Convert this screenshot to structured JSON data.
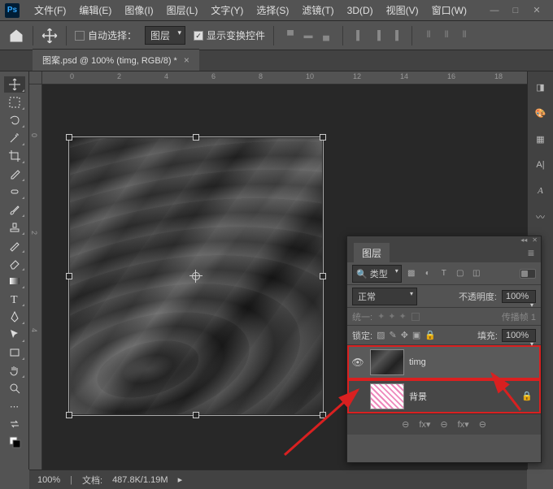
{
  "app": {
    "logo": "Ps"
  },
  "menu": {
    "file": "文件(F)",
    "edit": "编辑(E)",
    "image": "图像(I)",
    "layer": "图层(L)",
    "type": "文字(Y)",
    "select": "选择(S)",
    "filter": "滤镜(T)",
    "threed": "3D(D)",
    "view": "视图(V)",
    "window": "窗口(W)"
  },
  "options": {
    "auto_select_label": "自动选择：",
    "auto_select_mode": "图层",
    "show_transform_label": "显示变换控件"
  },
  "document": {
    "tab_title": "图案.psd @ 100% (timg, RGB/8) *"
  },
  "ruler": {
    "h": [
      "0",
      "2",
      "4",
      "6",
      "8",
      "10",
      "12",
      "14",
      "16",
      "18"
    ],
    "v": [
      "0",
      "2",
      "4"
    ]
  },
  "layers_panel": {
    "tab": "图层",
    "filter_label": "类型",
    "blend_mode": "正常",
    "opacity_label": "不透明度:",
    "opacity_value": "100%",
    "unify_label": "统一:",
    "propagate_label": "传播帧 1",
    "lock_label": "锁定:",
    "fill_label": "填充:",
    "fill_value": "100%",
    "items": [
      {
        "name": "timg",
        "visible": true,
        "selected": true,
        "locked": false
      },
      {
        "name": "背景",
        "visible": false,
        "selected": false,
        "locked": true
      }
    ],
    "footer_icons": [
      "⊖",
      "fx",
      "⊖",
      "fx",
      "⊖"
    ]
  },
  "status": {
    "zoom": "100%",
    "doc_label": "文档:",
    "doc_value": "487.8K/1.19M"
  }
}
